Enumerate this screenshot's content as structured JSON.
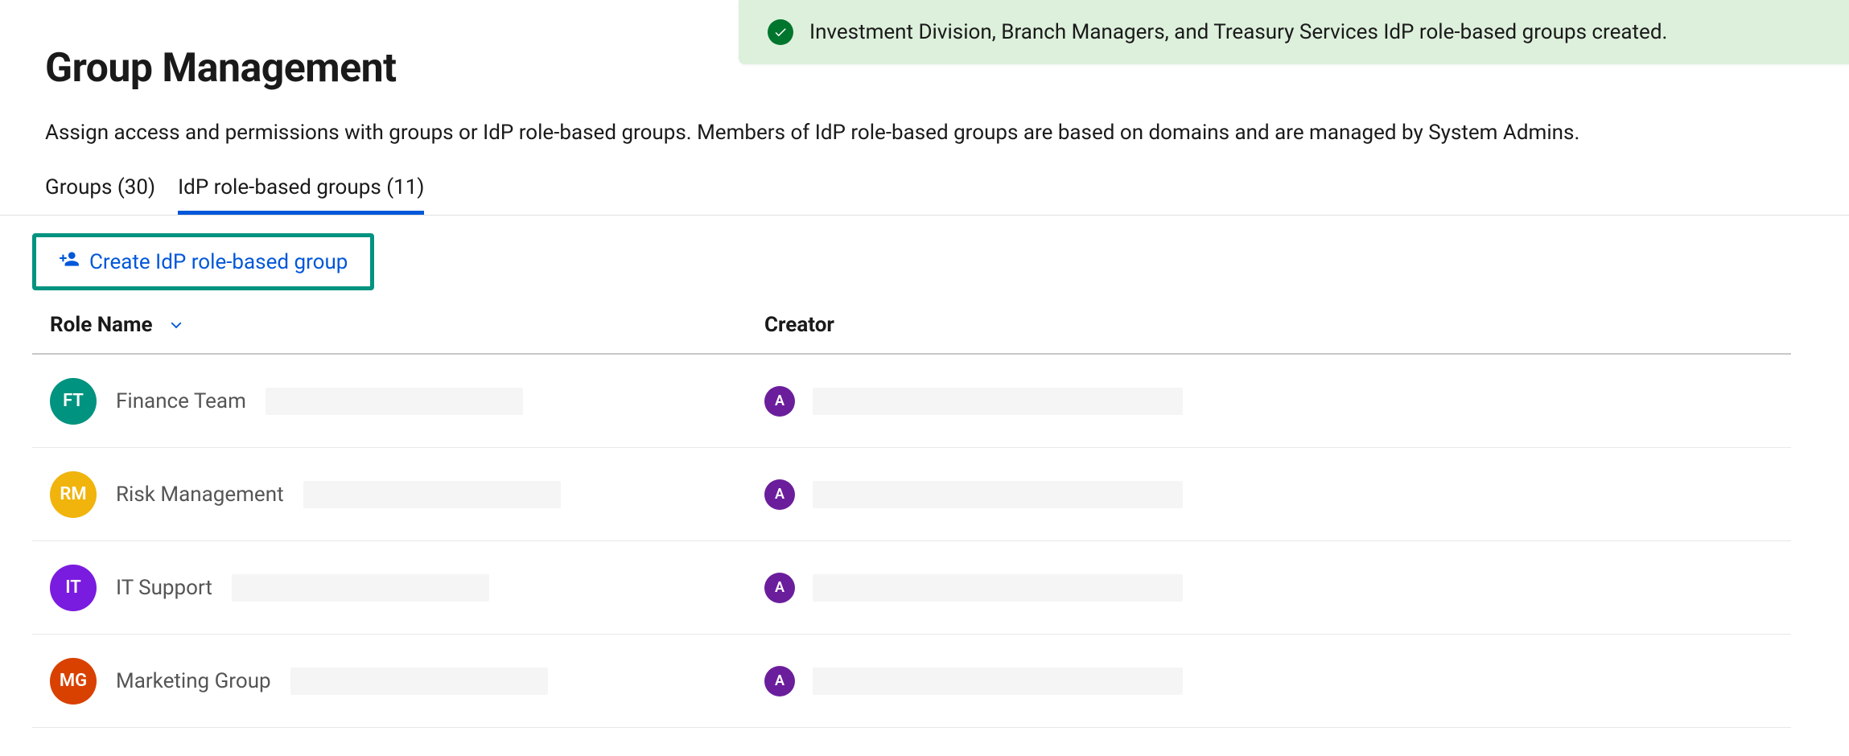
{
  "toast": {
    "message": "Investment Division, Branch Managers, and Treasury Services IdP role-based groups created."
  },
  "header": {
    "title": "Group Management",
    "subtitle": "Assign access and permissions with groups or IdP role-based groups. Members of IdP role-based groups are based on domains and are managed by System Admins."
  },
  "tabs": [
    {
      "label": "Groups (30)",
      "active": false
    },
    {
      "label": "IdP role-based groups (11)",
      "active": true
    }
  ],
  "actions": {
    "create_label": "Create IdP role-based group"
  },
  "table": {
    "columns": {
      "role": "Role Name",
      "creator": "Creator"
    },
    "rows": [
      {
        "role_initials": "FT",
        "role_name": "Finance Team",
        "role_color": "#009380",
        "creator_initial": "A",
        "creator_color": "#6b1e9c"
      },
      {
        "role_initials": "RM",
        "role_name": "Risk Management",
        "role_color": "#f0b40d",
        "creator_initial": "A",
        "creator_color": "#6b1e9c"
      },
      {
        "role_initials": "IT",
        "role_name": "IT Support",
        "role_color": "#7a1be0",
        "creator_initial": "A",
        "creator_color": "#6b1e9c"
      },
      {
        "role_initials": "MG",
        "role_name": "Marketing Group",
        "role_color": "#d94100",
        "creator_initial": "A",
        "creator_color": "#6b1e9c"
      }
    ]
  }
}
